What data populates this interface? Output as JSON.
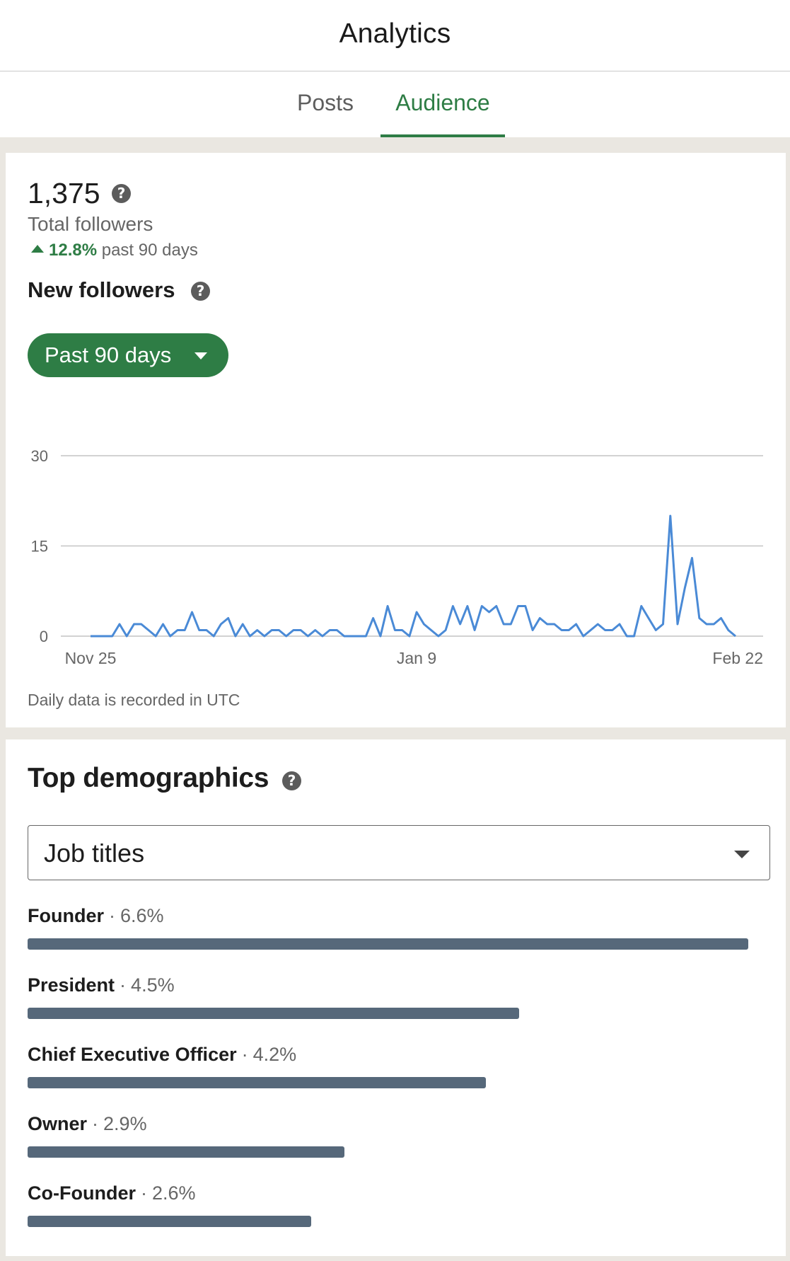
{
  "header": {
    "title": "Analytics"
  },
  "tabs": [
    {
      "label": "Posts",
      "active": false
    },
    {
      "label": "Audience",
      "active": true
    }
  ],
  "followers": {
    "total": "1,375",
    "total_label": "Total followers",
    "growth_pct": "12.8%",
    "growth_period": "past 90 days",
    "new_followers_title": "New followers",
    "range_label": "Past 90 days",
    "note": "Daily data is recorded in UTC"
  },
  "chart_data": {
    "type": "line",
    "x_start": "Nov 25",
    "x_end": "Feb 22",
    "x_tick_labels": [
      "Nov 25",
      "Jan 9",
      "Feb 22"
    ],
    "y_ticks": [
      0,
      15,
      30
    ],
    "ylim": [
      0,
      30
    ],
    "grid": true,
    "series": [
      {
        "color": "#4a8ad6",
        "values": [
          0,
          0,
          0,
          0,
          2,
          0,
          2,
          2,
          1,
          0,
          2,
          0,
          1,
          1,
          4,
          1,
          1,
          0,
          2,
          3,
          0,
          2,
          0,
          1,
          0,
          1,
          1,
          0,
          1,
          1,
          0,
          1,
          0,
          1,
          1,
          0,
          0,
          0,
          0,
          3,
          0,
          5,
          1,
          1,
          0,
          4,
          2,
          1,
          0,
          1,
          5,
          2,
          5,
          1,
          5,
          4,
          5,
          2,
          2,
          5,
          5,
          1,
          3,
          2,
          2,
          1,
          1,
          2,
          0,
          1,
          2,
          1,
          1,
          2,
          0,
          0,
          5,
          3,
          1,
          2,
          20,
          2,
          8,
          13,
          3,
          2,
          2,
          3,
          1,
          0
        ]
      }
    ]
  },
  "demographics": {
    "title": "Top demographics",
    "selected": "Job titles",
    "items": [
      {
        "label": "Founder",
        "pct": "6.6%",
        "value": 6.6
      },
      {
        "label": "President",
        "pct": "4.5%",
        "value": 4.5
      },
      {
        "label": "Chief Executive Officer",
        "pct": "4.2%",
        "value": 4.2
      },
      {
        "label": "Owner",
        "pct": "2.9%",
        "value": 2.9
      },
      {
        "label": "Co-Founder",
        "pct": "2.6%",
        "value": 2.6
      }
    ]
  },
  "colors": {
    "accent": "#2e7d45",
    "line": "#4a8ad6",
    "bar": "#56687a"
  }
}
